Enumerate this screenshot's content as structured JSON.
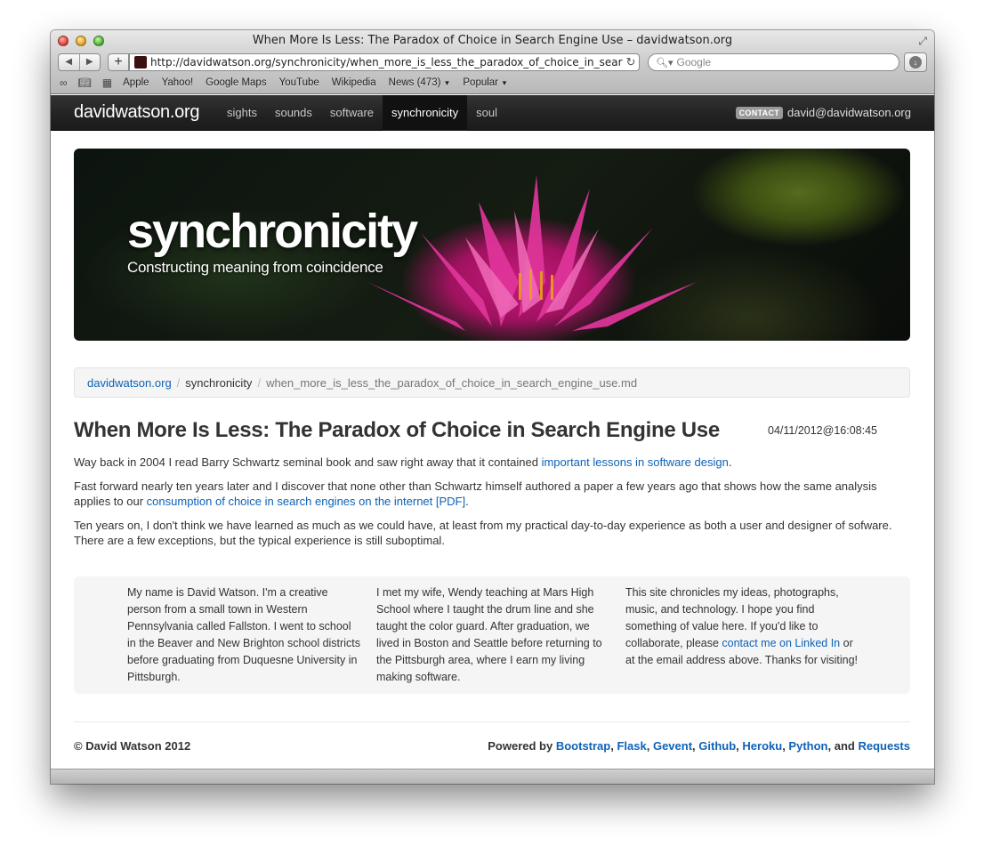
{
  "window": {
    "title": "When More Is Less: The Paradox of Choice in Search Engine Use – davidwatson.org",
    "url": "http://davidwatson.org/synchronicity/when_more_is_less_the_paradox_of_choice_in_search_engine_use.md",
    "search_placeholder": "Google",
    "bookmarks": [
      "Apple",
      "Yahoo!",
      "Google Maps",
      "YouTube",
      "Wikipedia",
      "News (473)",
      "Popular"
    ]
  },
  "nav": {
    "brand": "davidwatson.org",
    "links": [
      "sights",
      "sounds",
      "software",
      "synchronicity",
      "soul"
    ],
    "active": "synchronicity",
    "contact_badge": "CONTACT",
    "contact_email": "david@davidwatson.org"
  },
  "hero": {
    "title": "synchronicity",
    "subtitle": "Constructing meaning from coincidence"
  },
  "breadcrumb": {
    "home": "davidwatson.org",
    "section": "synchronicity",
    "file": "when_more_is_less_the_paradox_of_choice_in_search_engine_use.md",
    "separator": "/"
  },
  "post": {
    "title": "When More Is Less: The Paradox of Choice in Search Engine Use",
    "timestamp": "04/11/2012@16:08:45",
    "p1_text": "Way back in 2004 I read Barry Schwartz seminal book and saw right away that it contained ",
    "p1_link": "important lessons in software design",
    "p1_end": ".",
    "p2_text": "Fast forward nearly ten years later and I discover that none other than Schwartz himself authored a paper a few years ago that shows how the same analysis applies to our ",
    "p2_link": "consumption of choice in search engines on the internet [PDF]",
    "p2_end": ".",
    "p3_text": "Ten years on, I don't think we have learned as much as we could have, at least from my practical day-to-day experience as both a user and designer of sofware. There are a few exceptions, but the typical experience is still suboptimal."
  },
  "about": {
    "col1": "My name is David Watson. I'm a creative person from a small town in Western Pennsylvania called Fallston. I went to school in the Beaver and New Brighton school districts before graduating from Duquesne University in Pittsburgh.",
    "col2": "I met my wife, Wendy teaching at Mars High School where I taught the drum line and she taught the color guard. After graduation, we lived in Boston and Seattle before returning to the Pittsburgh area, where I earn my living making software.",
    "col3_text": "This site chronicles my ideas, photographs, music, and technology. I hope you find something of value here. If you'd like to collaborate, please ",
    "col3_link": "contact me on Linked In",
    "col3_end": " or at the email address above. Thanks for visiting!"
  },
  "footer": {
    "copyright": "© David Watson 2012",
    "powered_by": "Powered by",
    "and": "and",
    "links": [
      "Bootstrap",
      "Flask",
      "Gevent",
      "Github",
      "Heroku",
      "Python",
      "Requests"
    ]
  },
  "colors": {
    "link": "#0e62b7",
    "navbar": "#222222",
    "hero_flower": "#c8197e"
  }
}
